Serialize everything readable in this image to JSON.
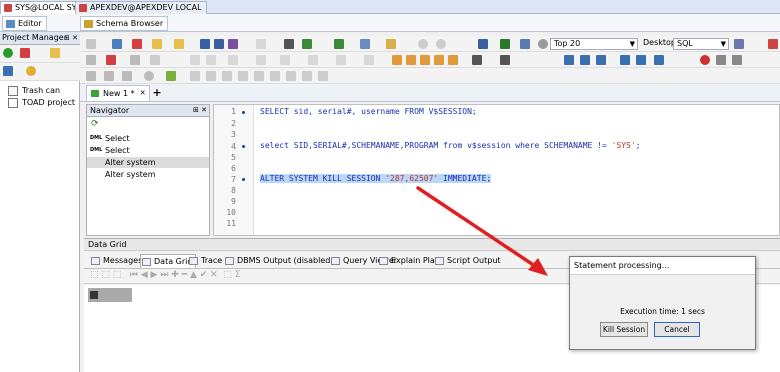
{
  "connections": [
    {
      "label": "SYS@LOCAL SYS",
      "active": true
    },
    {
      "label": "APEXDEV@APEXDEV LOCAL",
      "active": false
    }
  ],
  "modes": {
    "editor": "Editor",
    "schema_browser": "Schema Browser"
  },
  "project_manager": {
    "title": "Project Manager",
    "items": [
      "Trash can",
      "TOAD project"
    ]
  },
  "toolbar": {
    "top_combo": "Top 20",
    "desktop_label": "Desktop:",
    "desktop_value": "SQL"
  },
  "editor_tab": {
    "label": "New 1 *"
  },
  "navigator": {
    "title": "Navigator",
    "items": [
      {
        "tag": "DML",
        "label": "Select"
      },
      {
        "tag": "DML",
        "label": "Select"
      },
      {
        "tag": "",
        "label": "Alter system",
        "selected": true
      },
      {
        "tag": "",
        "label": "Alter system"
      }
    ]
  },
  "editor": {
    "lines": [
      "1",
      "2",
      "3",
      "4",
      "5",
      "6",
      "7",
      "8",
      "9",
      "10",
      "11"
    ],
    "code": [
      {
        "pre": "SELECT sid, serial#, username FROM V$SESSION;",
        "str": "",
        "post": ""
      },
      {
        "pre": "select SID,SERIAL#,SCHEMANAME,PROGRAM from v$session where SCHEMANAME != ",
        "str": "'SYS'",
        "post": ";"
      },
      {
        "pre": "ALTER SYSTEM KILL SESSION ",
        "str": "'287,62507'",
        "post": " IMMEDIATE;"
      }
    ]
  },
  "data_grid": {
    "title": "Data Grid",
    "tabs": [
      "Messages",
      "Data Grid",
      "Trace",
      "DBMS Output (disabled)",
      "Query Viewer",
      "Explain Plan",
      "Script Output"
    ]
  },
  "dialog": {
    "title": "Statement processing...",
    "execution_time": "Execution time: 1 secs",
    "kill_button": "Kill Session",
    "cancel_button": "Cancel"
  },
  "colors": {
    "arrow": "#e02020",
    "selection": "#b9d7f7",
    "keyword": "#1a2fb0",
    "string": "#c03030"
  }
}
